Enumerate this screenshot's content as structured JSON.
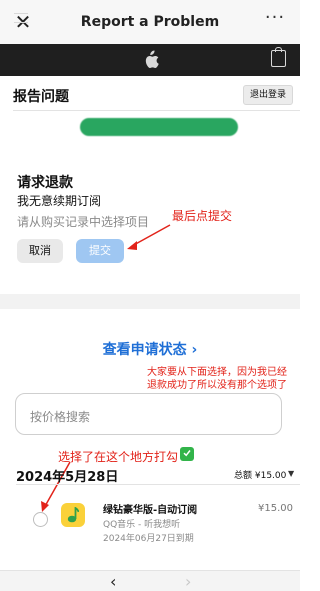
{
  "topbar": {
    "title": "Report a Problem",
    "close_icon": "close-icon",
    "more_icon": "more-icon"
  },
  "apple_nav": {
    "menu_icon": "menu-icon",
    "logo": "apple-logo",
    "bag_icon": "bag-icon"
  },
  "header": {
    "title": "报告问题",
    "signout_label": "退出登录"
  },
  "refund": {
    "title": "请求退款",
    "reason": "我无意续期订阅",
    "hint": "请从购买记录中选择项目",
    "cancel_label": "取消",
    "submit_label": "提交"
  },
  "status_link": "查看申请状态 ›",
  "search": {
    "placeholder": "按价格搜索"
  },
  "purchases": {
    "date": "2024年5月28日",
    "total": "总额 ¥15.00",
    "items": [
      {
        "name": "绿钻豪华版-自动订阅",
        "app": "QQ音乐 - 听我想听",
        "expire": "2024年06月27日到期",
        "price": "¥15.00"
      }
    ]
  },
  "annotations": {
    "submit_note": "最后点提交",
    "select_note": "大家要从下面选择，因为我已经退款成功了所以没有那个选项了",
    "tick_note": "选择了在这个地方打勾"
  },
  "nav": {
    "back": "‹",
    "forward": "›"
  },
  "colors": {
    "link": "#1f6fd6",
    "annotation": "#e2231a",
    "submit_bg": "#9fc7f2",
    "app_icon": "#fad13a"
  }
}
